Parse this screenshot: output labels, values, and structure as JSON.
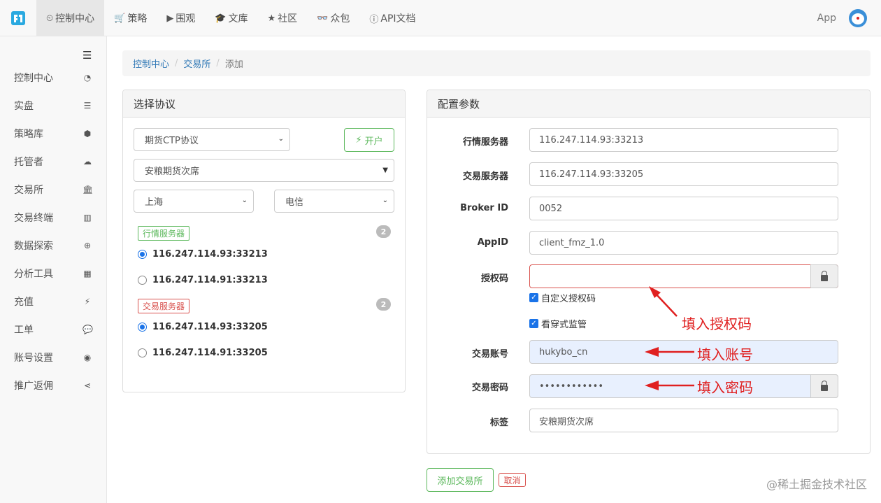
{
  "topnav": {
    "items": [
      {
        "icon": "dashboard-icon",
        "glyph": "⏲",
        "label": "控制中心"
      },
      {
        "icon": "cart-icon",
        "glyph": "🛒",
        "label": "策略"
      },
      {
        "icon": "play-icon",
        "glyph": "▶",
        "label": "围观"
      },
      {
        "icon": "graduation-icon",
        "glyph": "🎓",
        "label": "文库"
      },
      {
        "icon": "star-icon",
        "glyph": "★",
        "label": "社区"
      },
      {
        "icon": "glasses-icon",
        "glyph": "👓",
        "label": "众包"
      },
      {
        "icon": "info-icon",
        "glyph": "ⓘ",
        "label": "API文档"
      }
    ],
    "app_label": "App"
  },
  "sidebar": {
    "items": [
      {
        "label": "控制中心",
        "icon": "tachometer-icon",
        "glyph": "◔"
      },
      {
        "label": "实盘",
        "icon": "server-icon",
        "glyph": "☰"
      },
      {
        "label": "策略库",
        "icon": "cube-icon",
        "glyph": "⬢"
      },
      {
        "label": "托管者",
        "icon": "cloud-icon",
        "glyph": "☁"
      },
      {
        "label": "交易所",
        "icon": "bank-icon",
        "glyph": "🏛"
      },
      {
        "label": "交易终端",
        "icon": "bar-chart-icon",
        "glyph": "▥"
      },
      {
        "label": "数据探索",
        "icon": "search-plus-icon",
        "glyph": "⊕"
      },
      {
        "label": "分析工具",
        "icon": "calculator-icon",
        "glyph": "▦"
      },
      {
        "label": "充值",
        "icon": "plug-icon",
        "glyph": "⚡"
      },
      {
        "label": "工单",
        "icon": "comment-icon",
        "glyph": "💬"
      },
      {
        "label": "账号设置",
        "icon": "user-circle-icon",
        "glyph": "◉"
      },
      {
        "label": "推广返佣",
        "icon": "share-icon",
        "glyph": "⋖"
      }
    ]
  },
  "breadcrumb": {
    "home": "控制中心",
    "exchange": "交易所",
    "current": "添加"
  },
  "protocol_panel": {
    "title": "选择协议",
    "protocol_select": "期货CTP协议",
    "open_button": "开户",
    "broker_select": "安粮期货次席",
    "city_select": "上海",
    "carrier_select": "电信",
    "market_tag": "行情服务器",
    "market_count": "2",
    "market_servers": [
      "116.247.114.93:33213",
      "116.247.114.91:33213"
    ],
    "trade_tag": "交易服务器",
    "trade_count": "2",
    "trade_servers": [
      "116.247.114.93:33205",
      "116.247.114.91:33205"
    ]
  },
  "config_panel": {
    "title": "配置参数",
    "market_server_label": "行情服务器",
    "market_server_value": "116.247.114.93:33213",
    "trade_server_label": "交易服务器",
    "trade_server_value": "116.247.114.93:33205",
    "broker_id_label": "Broker ID",
    "broker_id_value": "0052",
    "appid_label": "AppID",
    "appid_value": "client_fmz_1.0",
    "auth_code_label": "授权码",
    "auth_code_value": "",
    "custom_auth_label": "自定义授权码",
    "penetration_label": "看穿式监管",
    "account_label": "交易账号",
    "account_value": "hukybo_cn",
    "password_label": "交易密码",
    "password_value": "••••••••••••",
    "tag_label": "标签",
    "tag_value": "安粮期货次席"
  },
  "actions": {
    "add": "添加交易所",
    "cancel": "取消"
  },
  "annotations": {
    "auth": "填入授权码",
    "account": "填入账号",
    "password": "填入密码"
  },
  "watermark": "@稀土掘金技术社区",
  "colors": {
    "accent_green": "#5cb85c",
    "danger_red": "#d9534f",
    "link_blue": "#337ab7",
    "annotation_red": "#e02020"
  }
}
